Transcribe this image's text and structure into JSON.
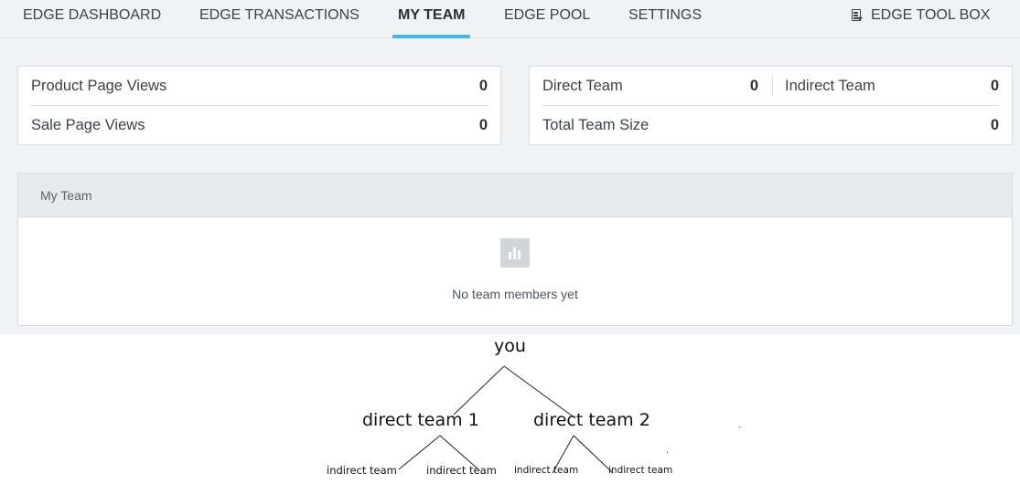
{
  "nav": {
    "tabs": [
      {
        "label": "EDGE DASHBOARD"
      },
      {
        "label": "EDGE TRANSACTIONS"
      },
      {
        "label": "MY TEAM"
      },
      {
        "label": "EDGE POOL"
      },
      {
        "label": "SETTINGS"
      }
    ],
    "active_tab": "MY TEAM",
    "toolbox": {
      "label": "EDGE TOOL BOX",
      "icon": "download-document-icon"
    }
  },
  "views_card": {
    "product_page_views": {
      "label": "Product Page Views",
      "value": "0"
    },
    "sale_page_views": {
      "label": "Sale Page Views",
      "value": "0"
    }
  },
  "team_card": {
    "direct_team": {
      "label": "Direct Team",
      "value": "0"
    },
    "indirect_team": {
      "label": "Indirect Team",
      "value": "0"
    },
    "total_team_size": {
      "label": "Total Team Size",
      "value": "0"
    }
  },
  "my_team_panel": {
    "title": "My Team",
    "empty_icon": "bar-chart-icon",
    "empty_message": "No team members yet"
  },
  "tree": {
    "root": "you",
    "direct": [
      "direct team 1",
      "direct team 2"
    ],
    "indirect": [
      "indirect team",
      "indirect team",
      "indirect team",
      "indirect team"
    ]
  },
  "colors": {
    "accent": "#4fb4de",
    "page_bg": "#f0f2f4",
    "panel_header_bg": "#e7eaed",
    "border": "#d9dde1",
    "empty_icon": "#d2d5d8"
  }
}
